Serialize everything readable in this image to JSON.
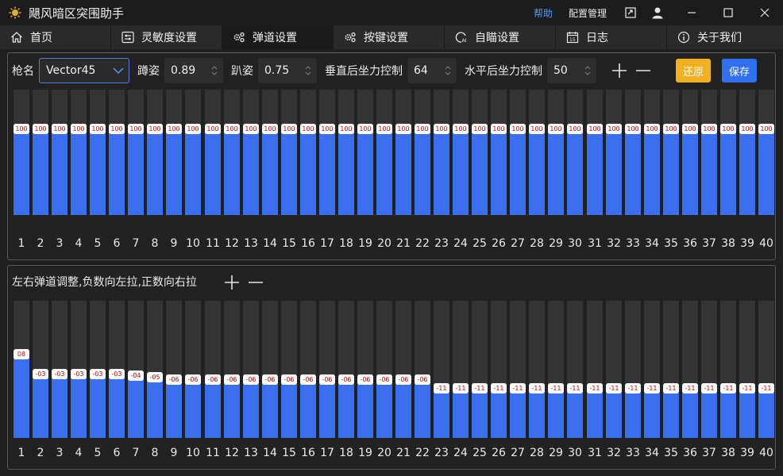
{
  "app": {
    "title": "飓风暗区突围助手"
  },
  "titlebar": {
    "help": "帮助",
    "config": "配置管理"
  },
  "tabs": [
    {
      "label": "首页",
      "icon": "home-icon"
    },
    {
      "label": "灵敏度设置",
      "icon": "sliders-icon"
    },
    {
      "label": "弹道设置",
      "icon": "gears-icon"
    },
    {
      "label": "按键设置",
      "icon": "gears-icon"
    },
    {
      "label": "自瞄设置",
      "icon": "ai-aim-icon"
    },
    {
      "label": "日志",
      "icon": "calendar-icon"
    },
    {
      "label": "关于我们",
      "icon": "info-icon"
    }
  ],
  "active_tab": 2,
  "toolbar": {
    "gun_label": "枪名",
    "gun_value": "Vector45",
    "crouch_label": "蹲姿",
    "crouch_value": "0.89",
    "prone_label": "趴姿",
    "prone_value": "0.75",
    "vertical_label": "垂直后坐力控制",
    "vertical_value": "64",
    "horizontal_label": "水平后坐力控制",
    "horizontal_value": "50",
    "restore_label": "还原",
    "save_label": "保存"
  },
  "vertical_bars": {
    "max": 100,
    "values": [
      100,
      100,
      100,
      100,
      100,
      100,
      100,
      100,
      100,
      100,
      100,
      100,
      100,
      100,
      100,
      100,
      100,
      100,
      100,
      100,
      100,
      100,
      100,
      100,
      100,
      100,
      100,
      100,
      100,
      100,
      100,
      100,
      100,
      100,
      100,
      100,
      100,
      100,
      100,
      100
    ],
    "labels": [
      "100",
      "100",
      "100",
      "100",
      "100",
      "100",
      "100",
      "100",
      "100",
      "100",
      "100",
      "100",
      "100",
      "100",
      "100",
      "100",
      "100",
      "100",
      "100",
      "100",
      "100",
      "100",
      "100",
      "100",
      "100",
      "100",
      "100",
      "100",
      "100",
      "100",
      "100",
      "100",
      "100",
      "100",
      "100",
      "100",
      "100",
      "100",
      "100",
      "100"
    ]
  },
  "horizontal_section": {
    "title": "左右弹道调整,负数向左拉,正数向右拉",
    "values": [
      8,
      -3,
      -3,
      -3,
      -3,
      -3,
      -4,
      -5,
      -6,
      -6,
      -6,
      -6,
      -6,
      -6,
      -6,
      -6,
      -6,
      -6,
      -6,
      -6,
      -6,
      -6,
      -11,
      -11,
      -11,
      -11,
      -11,
      -11,
      -11,
      -11,
      -11,
      -11,
      -11,
      -11,
      -11,
      -11,
      -11,
      -11,
      -11,
      -11
    ],
    "labels": [
      "08",
      "-03",
      "-03",
      "-03",
      "-03",
      "-03",
      "-04",
      "-05",
      "-06",
      "-06",
      "-06",
      "-06",
      "-06",
      "-06",
      "-06",
      "-06",
      "-06",
      "-06",
      "-06",
      "-06",
      "-06",
      "-06",
      "-11",
      "-11",
      "-11",
      "-11",
      "-11",
      "-11",
      "-11",
      "-11",
      "-11",
      "-11",
      "-11",
      "-11",
      "-11",
      "-11",
      "-11",
      "-11",
      "-11",
      "-11"
    ]
  },
  "indices": [
    "1",
    "2",
    "3",
    "4",
    "5",
    "6",
    "7",
    "8",
    "9",
    "10",
    "11",
    "12",
    "13",
    "14",
    "15",
    "16",
    "17",
    "18",
    "19",
    "20",
    "21",
    "22",
    "23",
    "24",
    "25",
    "26",
    "27",
    "28",
    "29",
    "30",
    "31",
    "32",
    "33",
    "34",
    "35",
    "36",
    "37",
    "38",
    "39",
    "40"
  ],
  "colors": {
    "bar_fill": "#3a70f0",
    "bar_slot": "#343434",
    "restore": "#f0b020",
    "save": "#2f6ff0",
    "help_link": "#4d9bff",
    "badge_text": "#d40000"
  }
}
